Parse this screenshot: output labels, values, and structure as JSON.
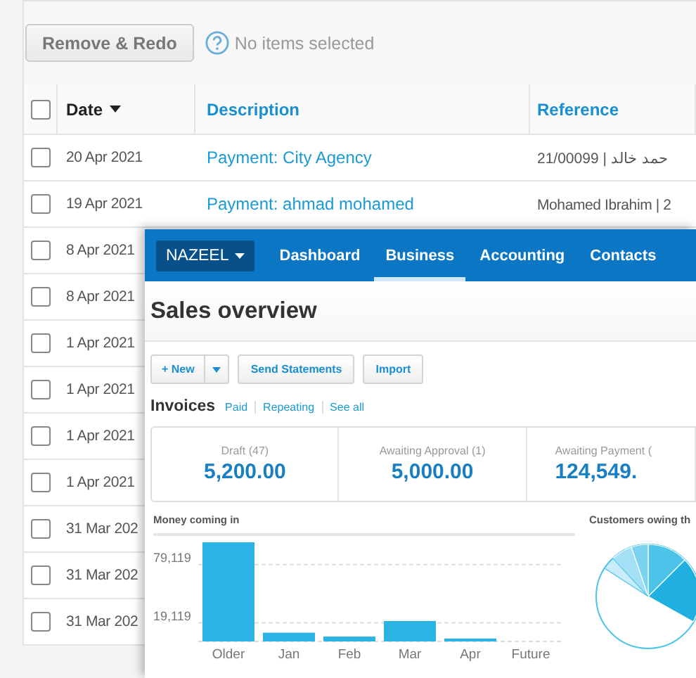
{
  "toolbar": {
    "button": "Remove & Redo",
    "status": "No items selected"
  },
  "table": {
    "select_all_checked": false,
    "columns": [
      "Date",
      "Description",
      "Reference"
    ],
    "rows": [
      {
        "checked": false,
        "date": "20 Apr 2021",
        "description": "Payment: City Agency",
        "reference": "21/00099 | حمد خالد"
      },
      {
        "checked": false,
        "date": "19 Apr 2021",
        "description": "Payment: ahmad mohamed",
        "reference": "Mohamed Ibrahim | 2"
      },
      {
        "checked": false,
        "date": "8 Apr 2021"
      },
      {
        "checked": false,
        "date": "8 Apr 2021"
      },
      {
        "checked": false,
        "date": "1 Apr 2021"
      },
      {
        "checked": false,
        "date": "1 Apr 2021"
      },
      {
        "checked": false,
        "date": "1 Apr 2021"
      },
      {
        "checked": false,
        "date": "1 Apr 2021"
      },
      {
        "checked": false,
        "date": "31 Mar 202"
      },
      {
        "checked": false,
        "date": "31 Mar 202"
      },
      {
        "checked": false,
        "date": "31 Mar 202"
      }
    ]
  },
  "overlay": {
    "org": "NAZEEL",
    "tabs": [
      {
        "label": "Dashboard",
        "selected": false
      },
      {
        "label": "Business",
        "selected": true
      },
      {
        "label": "Accounting",
        "selected": false
      },
      {
        "label": "Contacts",
        "selected": false
      }
    ],
    "title": "Sales overview",
    "buttons": {
      "new": "+ New",
      "send": "Send Statements",
      "import": "Import"
    },
    "invoices": {
      "heading": "Invoices",
      "links": [
        "Paid",
        "Repeating",
        "See all"
      ]
    },
    "cards": [
      {
        "label": "Draft (47)",
        "amount": "5,200.00"
      },
      {
        "label": "Awaiting Approval (1)",
        "amount": "5,000.00"
      },
      {
        "label": "Awaiting Payment (",
        "amount": "124,549."
      }
    ],
    "money_chart": {
      "title": "Money coming in",
      "chart_data": {
        "type": "bar",
        "categories": [
          "Older",
          "Jan",
          "Feb",
          "Mar",
          "Apr",
          "Future"
        ],
        "values": [
          102000,
          9000,
          5000,
          21000,
          3000,
          0
        ],
        "ylim": [
          0,
          110000
        ],
        "yticks": [
          {
            "value": 19119,
            "label": "19,119"
          },
          {
            "value": 79119,
            "label": "79,119"
          }
        ]
      }
    },
    "customers_chart": {
      "title": "Customers owing th"
    }
  }
}
